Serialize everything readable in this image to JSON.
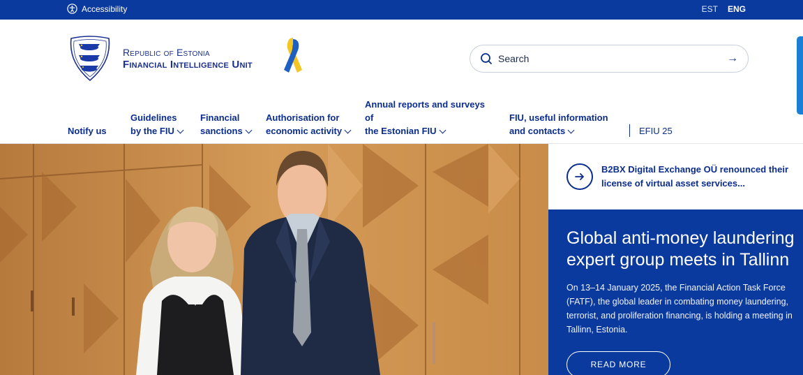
{
  "topbar": {
    "accessibility_label": "Accessibility",
    "languages": [
      {
        "label": "EST",
        "active": false
      },
      {
        "label": "ENG",
        "active": true
      }
    ]
  },
  "header": {
    "logo_line1": "Republic of Estonia",
    "logo_line2": "Financial Intelligence Unit",
    "search_placeholder": "Search",
    "search_submit": "→"
  },
  "nav": {
    "notify": "Notify us",
    "guidelines_1": "Guidelines",
    "guidelines_2": "by the FIU",
    "sanctions_1": "Financial",
    "sanctions_2": "sanctions",
    "authorisation_1": "Authorisation for",
    "authorisation_2": "economic activity",
    "reports_1": "Annual reports and surveys",
    "reports_2": "of",
    "reports_3": "the Estonian FIU",
    "contacts_1": "FIU, useful information",
    "contacts_2": "and contacts",
    "efiu": "EFIU 25"
  },
  "news": {
    "link_text": "B2BX Digital Exchange OÜ renounced their license of virtual asset services..."
  },
  "feature": {
    "title": "Global anti-money laundering expert group meets in Tallinn",
    "body": "On 13–14 January 2025, the Financial Action Task Force (FATF), the global leader in combating money laundering, terrorist, and proliferation financing, is holding a meeting in Tallinn, Estonia.",
    "button_label": "READ MORE"
  },
  "colors": {
    "brand_blue": "#0b3a9e",
    "text_blue": "#0b2d8c",
    "accent_tab": "#1c7fd6",
    "ribbon_blue": "#1f5fbf",
    "ribbon_yellow": "#f3c623"
  },
  "icons": {
    "accessibility": "accessibility-icon",
    "search": "search-icon",
    "arrow": "arrow-right-icon",
    "crest": "estonia-crest-icon",
    "ribbon": "ukraine-ribbon-icon"
  }
}
